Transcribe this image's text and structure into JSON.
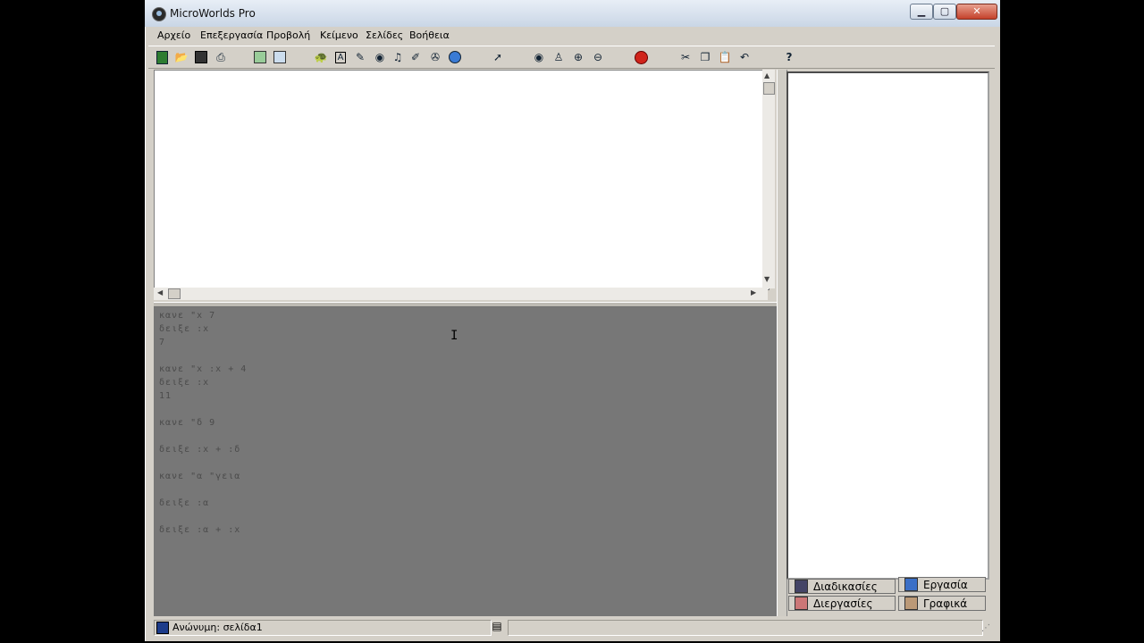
{
  "window": {
    "title": "MicroWorlds Pro"
  },
  "menu": [
    "Αρχείο",
    "Επεξεργασία",
    "Προβολή",
    "Κείμενο",
    "Σελίδες",
    "Βοήθεια"
  ],
  "toolbar_icons": [
    "new-file-icon",
    "open-folder-icon",
    "save-icon",
    "print-icon",
    "page-icon",
    "project-icon",
    "turtle-icon",
    "text-box-icon",
    "paint-icon",
    "eye-icon",
    "music-icon",
    "brush-icon",
    "video-icon",
    "globe-icon",
    "pointer-icon",
    "eye-icon",
    "stamp-icon",
    "zoom-in-icon",
    "zoom-out-icon",
    "stop-icon",
    "cut-icon",
    "copy-icon",
    "paste-icon",
    "undo-icon",
    "help-icon"
  ],
  "command_center": {
    "lines": [
      "κανε \"x 7",
      "δειξε :x",
      "7",
      "",
      "κανε \"x :x + 4",
      "δειξε :x",
      "11",
      "",
      "κανε \"δ 9",
      "",
      "δειξε :x + :δ",
      "",
      "κανε \"α \"γεια",
      "",
      "δειξε :α",
      "",
      "δειξε :α + :x"
    ]
  },
  "tabs": {
    "procedures": "Διαδικασίες",
    "project": "Εργασία",
    "processes": "Διεργασίες",
    "graphics": "Γραφικά"
  },
  "status": {
    "page_label": "Ανώνυμη: σελίδα1"
  }
}
